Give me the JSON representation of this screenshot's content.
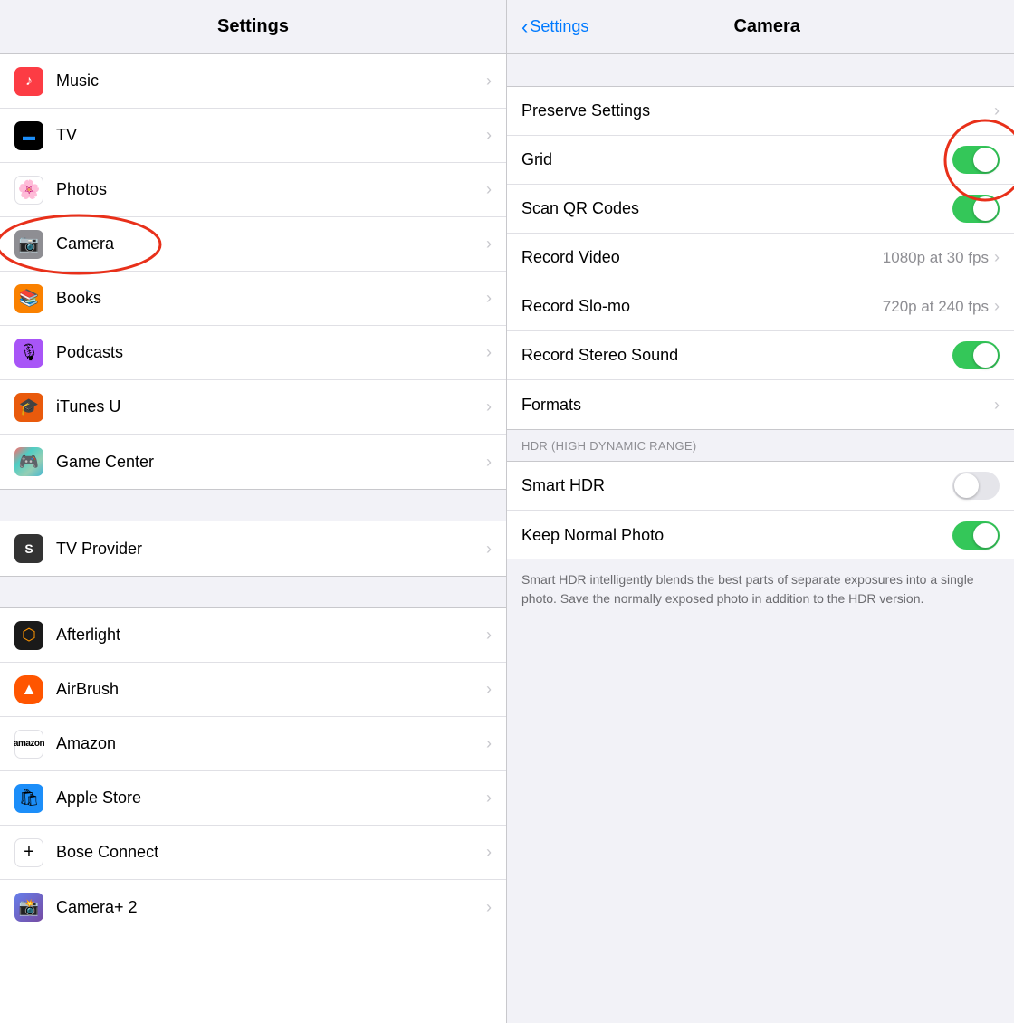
{
  "left": {
    "header": {
      "title": "Settings"
    },
    "items": [
      {
        "id": "music",
        "label": "Music",
        "iconBg": "#fc3c44",
        "iconText": "♪",
        "iconColor": "#fff"
      },
      {
        "id": "tv",
        "label": "TV",
        "iconBg": "#000",
        "iconText": "📺",
        "iconColor": "#fff"
      },
      {
        "id": "photos",
        "label": "Photos",
        "iconBg": "#fff",
        "iconText": "🌸",
        "iconColor": "#fff"
      },
      {
        "id": "camera",
        "label": "Camera",
        "iconBg": "#8e8e93",
        "iconText": "📷",
        "iconColor": "#fff",
        "circled": true
      },
      {
        "id": "books",
        "label": "Books",
        "iconBg": "#fa8100",
        "iconText": "📚",
        "iconColor": "#fff"
      },
      {
        "id": "podcasts",
        "label": "Podcasts",
        "iconBg": "#a855f7",
        "iconText": "🎙",
        "iconColor": "#fff"
      },
      {
        "id": "itunes",
        "label": "iTunes U",
        "iconBg": "#e95a0c",
        "iconText": "🎓",
        "iconColor": "#fff"
      },
      {
        "id": "gamecenter",
        "label": "Game Center",
        "iconBg": "multicolor",
        "iconText": "🎮",
        "iconColor": "#fff"
      }
    ],
    "separator1": true,
    "items2": [
      {
        "id": "tvprovider",
        "label": "TV Provider",
        "iconBg": "#333",
        "iconText": "S",
        "iconColor": "#fff"
      }
    ],
    "separator2": true,
    "items3": [
      {
        "id": "afterlight",
        "label": "Afterlight",
        "iconBg": "#1a1a1a",
        "iconText": "⬡",
        "iconColor": "#ff9500"
      },
      {
        "id": "airbrush",
        "label": "AirBrush",
        "iconBg": "#ff5500",
        "iconText": "🔺",
        "iconColor": "#fff"
      },
      {
        "id": "amazon",
        "label": "Amazon",
        "iconBg": "#fff",
        "iconText": "amazon",
        "iconColor": "#000"
      },
      {
        "id": "applestore",
        "label": "Apple Store",
        "iconBg": "#1c8ef9",
        "iconText": "🛍",
        "iconColor": "#fff"
      },
      {
        "id": "bose",
        "label": "Bose Connect",
        "iconBg": "#fff",
        "iconText": "+",
        "iconColor": "#000"
      },
      {
        "id": "camera2",
        "label": "Camera+ 2",
        "iconBg": "#764ba2",
        "iconText": "📸",
        "iconColor": "#fff"
      }
    ]
  },
  "right": {
    "header": {
      "back_label": "Settings",
      "title": "Camera"
    },
    "items": [
      {
        "id": "preserve",
        "label": "Preserve Settings",
        "type": "chevron",
        "value": ""
      },
      {
        "id": "grid",
        "label": "Grid",
        "type": "toggle",
        "on": true,
        "circled": true
      },
      {
        "id": "scanqr",
        "label": "Scan QR Codes",
        "type": "toggle",
        "on": true
      },
      {
        "id": "recordvideo",
        "label": "Record Video",
        "type": "value-chevron",
        "value": "1080p at 30 fps"
      },
      {
        "id": "recordslomo",
        "label": "Record Slo-mo",
        "type": "value-chevron",
        "value": "720p at 240 fps"
      },
      {
        "id": "recordstereo",
        "label": "Record Stereo Sound",
        "type": "toggle",
        "on": true
      },
      {
        "id": "formats",
        "label": "Formats",
        "type": "chevron",
        "value": ""
      }
    ],
    "hdr_section": {
      "label": "HDR (HIGH DYNAMIC RANGE)",
      "items": [
        {
          "id": "smarthdr",
          "label": "Smart HDR",
          "type": "toggle",
          "on": false
        },
        {
          "id": "keepnormal",
          "label": "Keep Normal Photo",
          "type": "toggle",
          "on": true
        }
      ],
      "description": "Smart HDR intelligently blends the best parts of separate exposures into a single photo. Save the normally exposed photo in addition to the HDR version."
    }
  }
}
